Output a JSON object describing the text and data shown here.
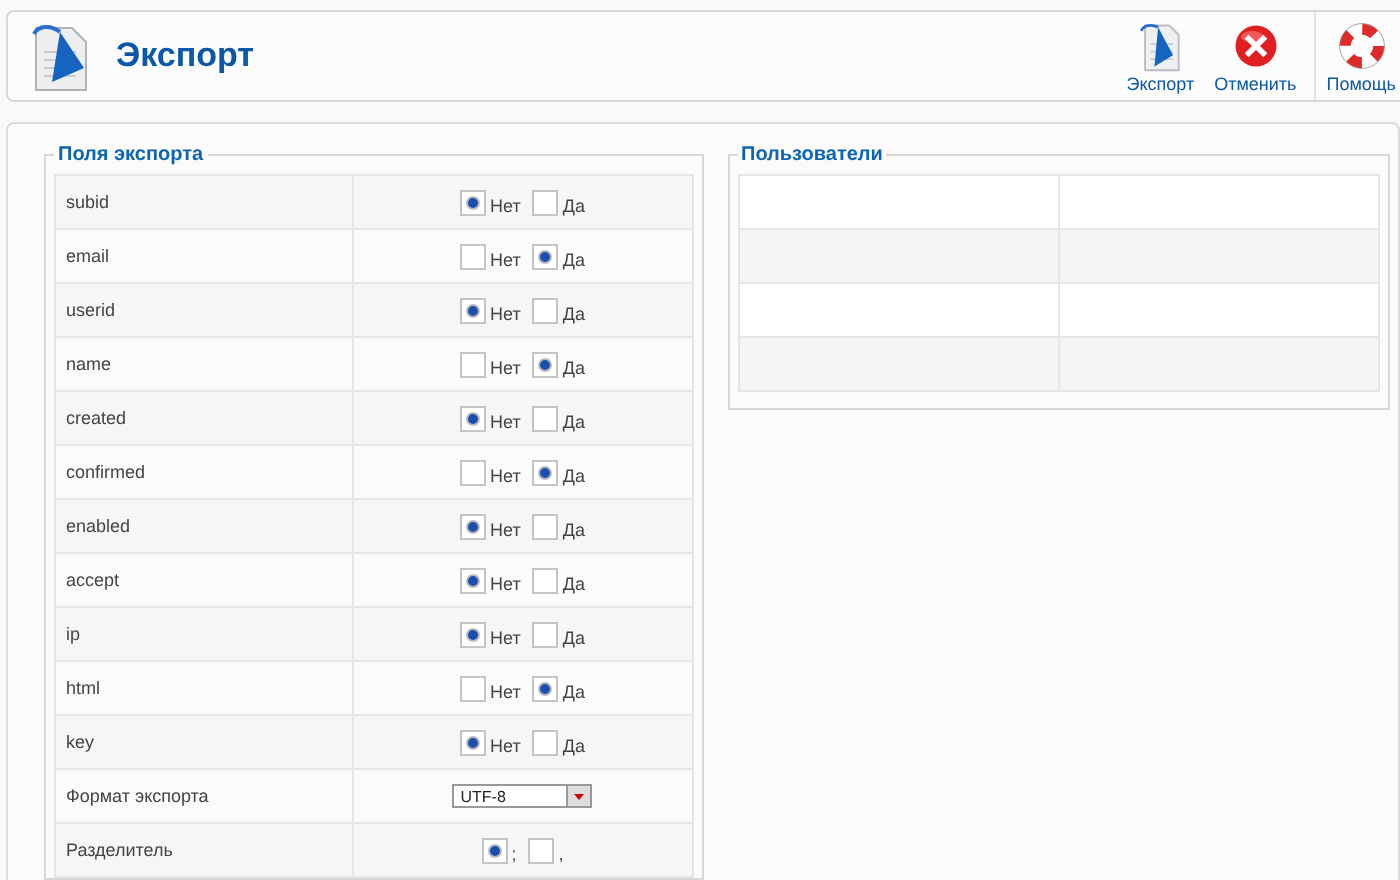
{
  "header": {
    "title": "Экспорт",
    "toolbar": [
      {
        "kind": "export",
        "label": "Экспорт"
      },
      {
        "kind": "cancel",
        "label": "Отменить"
      },
      {
        "kind": "help",
        "label": "Помощь"
      }
    ]
  },
  "export_fields": {
    "legend": "Поля экспорта",
    "rows": [
      {
        "kind": "radio",
        "label": "subid",
        "options": [
          {
            "label": "Нет",
            "selected": true
          },
          {
            "label": "Да",
            "selected": false
          }
        ]
      },
      {
        "kind": "radio",
        "label": "email",
        "options": [
          {
            "label": "Нет",
            "selected": false
          },
          {
            "label": "Да",
            "selected": true
          }
        ]
      },
      {
        "kind": "radio",
        "label": "userid",
        "options": [
          {
            "label": "Нет",
            "selected": true
          },
          {
            "label": "Да",
            "selected": false
          }
        ]
      },
      {
        "kind": "radio",
        "label": "name",
        "options": [
          {
            "label": "Нет",
            "selected": false
          },
          {
            "label": "Да",
            "selected": true
          }
        ]
      },
      {
        "kind": "radio",
        "label": "created",
        "options": [
          {
            "label": "Нет",
            "selected": true
          },
          {
            "label": "Да",
            "selected": false
          }
        ]
      },
      {
        "kind": "radio",
        "label": "confirmed",
        "options": [
          {
            "label": "Нет",
            "selected": false
          },
          {
            "label": "Да",
            "selected": true
          }
        ]
      },
      {
        "kind": "radio",
        "label": "enabled",
        "options": [
          {
            "label": "Нет",
            "selected": true
          },
          {
            "label": "Да",
            "selected": false
          }
        ]
      },
      {
        "kind": "radio",
        "label": "accept",
        "options": [
          {
            "label": "Нет",
            "selected": true
          },
          {
            "label": "Да",
            "selected": false
          }
        ]
      },
      {
        "kind": "radio",
        "label": "ip",
        "options": [
          {
            "label": "Нет",
            "selected": true
          },
          {
            "label": "Да",
            "selected": false
          }
        ]
      },
      {
        "kind": "radio",
        "label": "html",
        "options": [
          {
            "label": "Нет",
            "selected": false
          },
          {
            "label": "Да",
            "selected": true
          }
        ]
      },
      {
        "kind": "radio",
        "label": "key",
        "options": [
          {
            "label": "Нет",
            "selected": true
          },
          {
            "label": "Да",
            "selected": false
          }
        ]
      },
      {
        "kind": "select",
        "label": "Формат экспорта",
        "value": "UTF-8"
      },
      {
        "kind": "radio",
        "label": "Разделитель",
        "options": [
          {
            "label": ";",
            "selected": true
          },
          {
            "label": ",",
            "selected": false
          }
        ]
      }
    ]
  },
  "users": {
    "legend": "Пользователи"
  }
}
